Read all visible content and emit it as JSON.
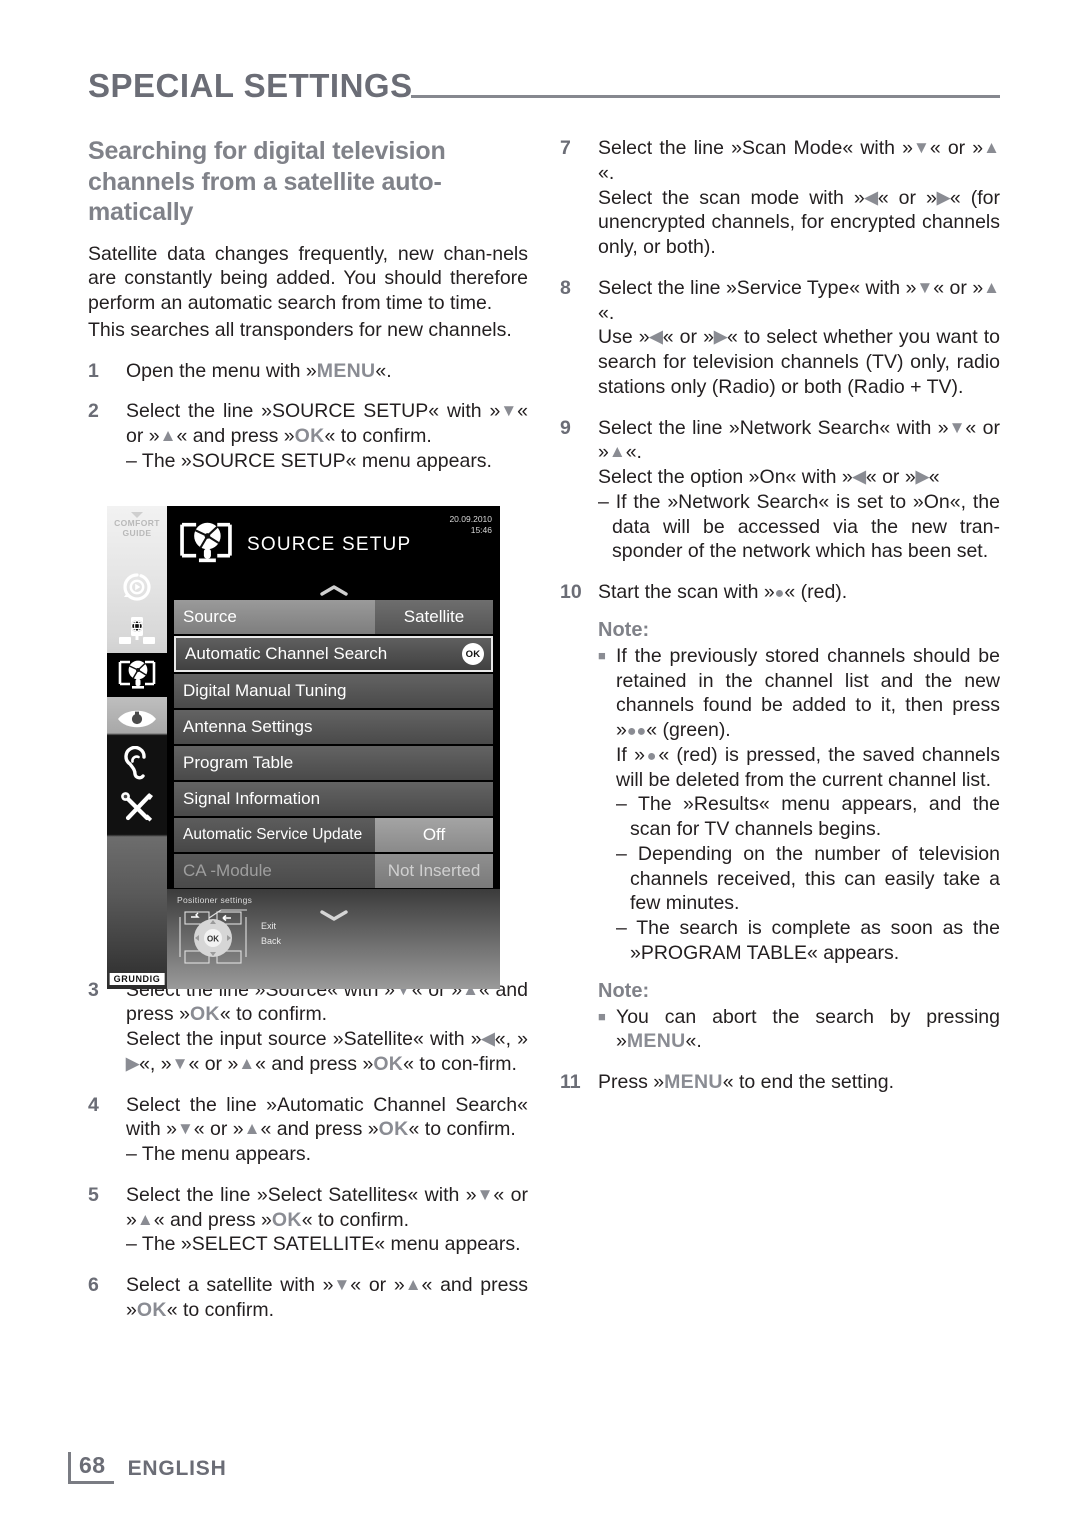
{
  "header": {
    "title": "SPECIAL SETTINGS"
  },
  "footer": {
    "page": "68",
    "language": "ENGLISH"
  },
  "left": {
    "section_title": "Searching for digital television channels from a satellite auto-matically",
    "intro1": "Satellite data changes frequently, new chan-nels are constantly being added. You should therefore perform an automatic search from time to time.",
    "intro2": "This searches all transponders for new channels.",
    "steps": [
      {
        "num": "1",
        "lines": [
          "Open the menu with »MENU«."
        ]
      },
      {
        "num": "2",
        "lines": [
          "Select the line »SOURCE SETUP« with »V« or »A« and press »OK« to confirm.",
          "– The »SOURCE SETUP« menu appears."
        ]
      },
      {
        "num": "3",
        "lines": [
          "Select the line »Source« with »V« or »A« and press »OK« to confirm.",
          "Select the input source »Satellite« with »<«, »>«, »V« or »A« and press »OK« to con-firm."
        ]
      },
      {
        "num": "4",
        "lines": [
          "Select the line »Automatic Channel Search« with »V« or »A« and press »OK« to confirm.",
          "– The menu appears."
        ]
      },
      {
        "num": "5",
        "lines": [
          "Select the line »Select Satellites« with »V« or »A« and press »OK« to confirm.",
          "– The »SELECT SATELLITE« menu appears."
        ]
      },
      {
        "num": "6",
        "lines": [
          "Select a satellite with »V« or »A« and press »OK« to confirm."
        ]
      }
    ]
  },
  "right": {
    "steps": [
      {
        "num": "7",
        "lines": [
          "Select the line »Scan Mode« with »V« or »A«.",
          "Select the scan mode with »<« or »>« (for unencrypted channels, for encrypted channels only, or both)."
        ]
      },
      {
        "num": "8",
        "lines": [
          "Select the line »Service Type« with »V« or »A«.",
          "Use »<« or »>« to select whether you want to search for television channels (TV) only, radio stations only (Radio) or both (Radio + TV)."
        ]
      },
      {
        "num": "9",
        "lines": [
          "Select the line »Network Search« with »V« or »A«.",
          "Select the option »On« with »<« or »>«",
          "– If the »Network Search« is set to »On«, the data will be accessed via the new tran-sponder of the network which has been set."
        ]
      },
      {
        "num": "10",
        "lines": [
          "Start the scan with »•« (red)."
        ]
      }
    ],
    "note1_head": "Note:",
    "note1_items": [
      "If the previously stored channels should be retained in the channel list and the new channels found be added to it, then press »••« (green).",
      "If »•« (red) is pressed, the saved channels will be deleted from the current channel list.",
      "– The »Results« menu appears, and the scan for TV channels begins.",
      "– Depending on the number of television channels received, this can easily take a few minutes.",
      "– The search is complete as soon as the »PROGRAM TABLE« appears."
    ],
    "note2_head": "Note:",
    "note2_items": [
      "You can abort the search by pressing »MENU«."
    ],
    "step11": {
      "num": "11",
      "lines": [
        "Press »MENU« to end the setting."
      ]
    }
  },
  "tv_menu": {
    "comfort_guide": "COMFORT GUIDE",
    "brand": "GRUNDIG",
    "title": "SOURCE SETUP",
    "date": "20.09.2010",
    "time": "15:46",
    "rows": [
      {
        "label": "Source",
        "value": "Satellite",
        "style": "split"
      },
      {
        "label": "Automatic Channel Search",
        "value": "OK",
        "style": "highlight"
      },
      {
        "label": "Digital Manual Tuning",
        "value": "",
        "style": "full"
      },
      {
        "label": "Antenna Settings",
        "value": "",
        "style": "full"
      },
      {
        "label": "Program Table",
        "value": "",
        "style": "full"
      },
      {
        "label": "Signal Information",
        "value": "",
        "style": "full"
      },
      {
        "label": "Automatic Service Update",
        "value": "Off",
        "style": "update"
      },
      {
        "label": "CA -Module",
        "value": "Not Inserted",
        "style": "disabled"
      }
    ],
    "positioner_label": "Positioner settings",
    "remote_labels": [
      "Exit",
      "Back"
    ]
  }
}
